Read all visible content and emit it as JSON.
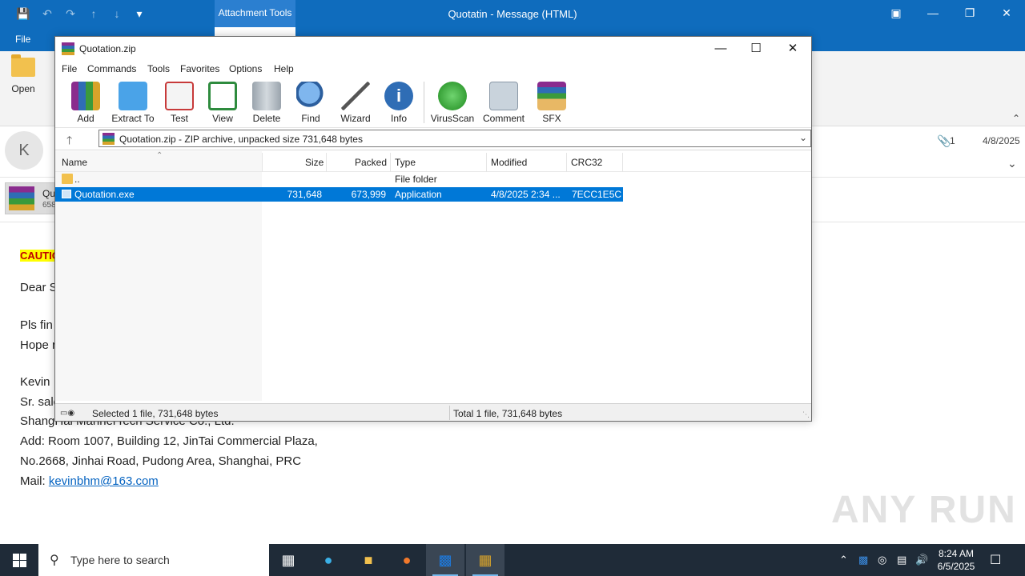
{
  "outlook": {
    "window_title": "Quotatin  -  Message (HTML)",
    "contextual_tab": "Attachment Tools",
    "file_tab": "File",
    "open_label": "Open",
    "attachment_count": "1",
    "received_date": "4/8/2025",
    "sender_initial": "K",
    "attachment_chip_name": "Qu",
    "attachment_chip_size": "658",
    "body": {
      "caution": "CAUTIO",
      "greeting": "Dear S",
      "line1": "Pls fin",
      "line2": "Hope r",
      "sig_name": "Kevin",
      "sig_title": "Sr. sale",
      "sig_company": "ShangHai MannerTech Service Co., Ltd.",
      "sig_addr1": "Add: Room 1007, Building 12, JinTai Commercial Plaza,",
      "sig_addr2": "No.2668, Jinhai Road, Pudong Area, Shanghai, PRC",
      "sig_mail_label": "Mail: ",
      "sig_mail": "kevinbhm@163.com"
    }
  },
  "winrar": {
    "title": "Quotation.zip",
    "menu": [
      "File",
      "Commands",
      "Tools",
      "Favorites",
      "Options",
      "Help"
    ],
    "toolbar": [
      {
        "label": "Add",
        "icon": "add-archive-icon"
      },
      {
        "label": "Extract To",
        "icon": "extract-folder-icon"
      },
      {
        "label": "Test",
        "icon": "test-clipboard-icon"
      },
      {
        "label": "View",
        "icon": "view-book-icon"
      },
      {
        "label": "Delete",
        "icon": "trash-icon"
      },
      {
        "label": "Find",
        "icon": "magnifier-icon"
      },
      {
        "label": "Wizard",
        "icon": "magic-wand-icon"
      },
      {
        "label": "Info",
        "icon": "info-icon"
      },
      {
        "label": "VirusScan",
        "icon": "virus-scan-icon"
      },
      {
        "label": "Comment",
        "icon": "comment-icon"
      },
      {
        "label": "SFX",
        "icon": "sfx-box-icon"
      }
    ],
    "address": "Quotation.zip - ZIP archive, unpacked size 731,648 bytes",
    "columns": [
      "Name",
      "Size",
      "Packed",
      "Type",
      "Modified",
      "CRC32"
    ],
    "rows": [
      {
        "name": "..",
        "size": "",
        "packed": "",
        "type": "File folder",
        "modified": "",
        "crc": ""
      },
      {
        "name": "Quotation.exe",
        "size": "731,648",
        "packed": "673,999",
        "type": "Application",
        "modified": "4/8/2025 2:34 ...",
        "crc": "7ECC1E5C"
      }
    ],
    "status_left": "Selected 1 file, 731,648 bytes",
    "status_right": "Total 1 file, 731,648 bytes"
  },
  "taskbar": {
    "search_placeholder": "Type here to search",
    "time": "8:24 AM",
    "date": "6/5/2025"
  },
  "watermark": "ANY RUN"
}
